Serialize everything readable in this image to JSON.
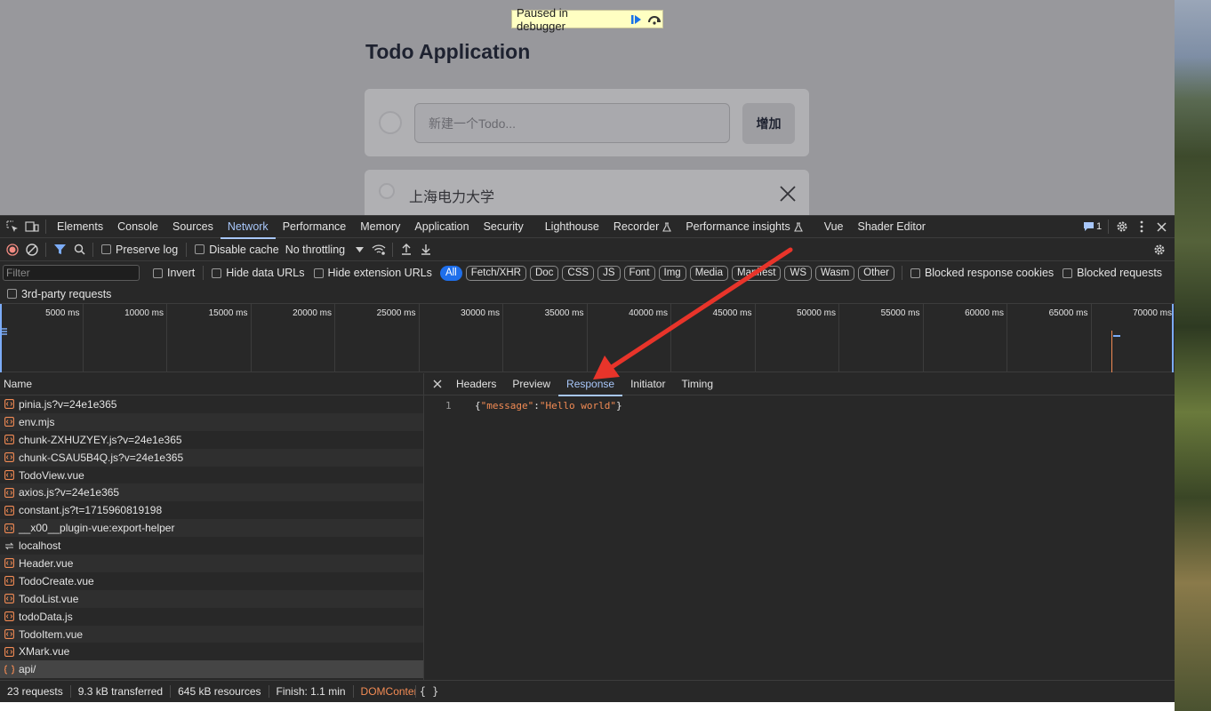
{
  "page": {
    "paused_text": "Paused in debugger",
    "title": "Todo Application",
    "input_placeholder": "新建一个Todo...",
    "add_button": "增加",
    "todo_item": "上海电力大学"
  },
  "devtools": {
    "tabs": [
      "Elements",
      "Console",
      "Sources",
      "Network",
      "Performance",
      "Memory",
      "Application",
      "Security",
      "Lighthouse",
      "Recorder",
      "Performance insights",
      "Vue",
      "Shader Editor"
    ],
    "active_tab": "Network",
    "issues_count": "1",
    "toolbar": {
      "preserve_log": "Preserve log",
      "disable_cache": "Disable cache",
      "throttling": "No throttling"
    },
    "filter": {
      "placeholder": "Filter",
      "invert": "Invert",
      "hide_data_urls": "Hide data URLs",
      "hide_extension_urls": "Hide extension URLs",
      "types": [
        "All",
        "Fetch/XHR",
        "Doc",
        "CSS",
        "JS",
        "Font",
        "Img",
        "Media",
        "Manifest",
        "WS",
        "Wasm",
        "Other"
      ],
      "blocked_cookies": "Blocked response cookies",
      "blocked_requests": "Blocked requests",
      "third_party": "3rd-party requests"
    },
    "overview_ticks": [
      "5000 ms",
      "10000 ms",
      "15000 ms",
      "20000 ms",
      "25000 ms",
      "30000 ms",
      "35000 ms",
      "40000 ms",
      "45000 ms",
      "50000 ms",
      "55000 ms",
      "60000 ms",
      "65000 ms",
      "70000 ms"
    ],
    "name_header": "Name",
    "requests": [
      "pinia.js?v=24e1e365",
      "env.mjs",
      "chunk-ZXHUZYEY.js?v=24e1e365",
      "chunk-CSAU5B4Q.js?v=24e1e365",
      "TodoView.vue",
      "axios.js?v=24e1e365",
      "constant.js?t=1715960819198",
      "__x00__plugin-vue:export-helper",
      "localhost",
      "Header.vue",
      "TodoCreate.vue",
      "TodoList.vue",
      "todoData.js",
      "TodoItem.vue",
      "XMark.vue",
      "api/"
    ],
    "detail_tabs": [
      "Headers",
      "Preview",
      "Response",
      "Initiator",
      "Timing"
    ],
    "active_detail_tab": "Response",
    "response": {
      "line_number": "1",
      "key": "\"message\"",
      "value": "\"Hello world\""
    },
    "status": {
      "requests": "23 requests",
      "transferred": "9.3 kB transferred",
      "resources": "645 kB resources",
      "finish": "Finish: 1.1 min",
      "dom": "DOMConter"
    }
  },
  "colors": {
    "accent": "#a8c7fa",
    "arrow": "#e8342a",
    "json": "#f28b54"
  }
}
